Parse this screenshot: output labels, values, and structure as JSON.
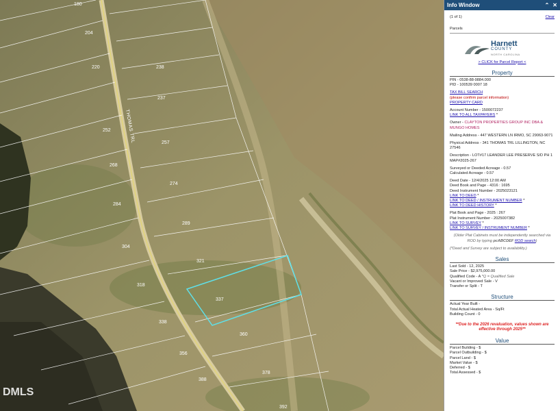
{
  "map": {
    "watermark": "DMLS",
    "road_label": "THOMAS TRL",
    "parcel_labels": [
      "180",
      "204",
      "220",
      "238",
      "237",
      "252",
      "257",
      "268",
      "274",
      "284",
      "289",
      "304",
      "321",
      "318",
      "337",
      "338",
      "360",
      "356",
      "378",
      "388",
      "392"
    ]
  },
  "info_window": {
    "title": "Info Window",
    "collapse_icon": "chevron-up-icon",
    "close_icon": "close-icon",
    "count": "(1 of 1)",
    "clear_label": "Clear",
    "section_label": "Parcels",
    "logo": {
      "name": "Harnett",
      "county": "COUNTY",
      "state": "NORTH CAROLINA"
    },
    "parcel_report_link": "> CLICK for Parcel Report <",
    "property": {
      "heading": "Property",
      "pin": "PIN - 0538-88-9884.000",
      "pid": "PID - 100539 0007 18",
      "tax_bill_link": "TAX BILL SEARCH",
      "tax_bill_note": "(please confirm parcel information)",
      "property_card_link": "PROPERTY CARD",
      "account_number": "Account Number - 1500072237",
      "all_taxpayers_link": "LINK TO ALL TAXPAYERS",
      "owner_label": "Owner - ",
      "owner_value": "CLAYTON PROPERTIES GROUP INC DBA & MUNGO HOMES",
      "mailing_address": "Mailing Address - 447 WESTERN LN IRMO, SC 29063-9071",
      "physical_address": "Physical Address - 341 THOMAS TRL LILLINGTON, NC 27546",
      "description": "Description - LOT#17 LEANDER LEE PRESERVE S/D PH 1 MAP#2025-267",
      "surveyed_acreage": "Surveyed or Deeded Acreage - 0.57",
      "calculated_acreage": "Calculated Acreage - 0.57",
      "deed_date": "Deed Date - 12/4/2025 12:00 AM",
      "deed_book_page": "Deed Book and Page - 4316 : 1695",
      "deed_instrument": "Deed Instrument Number - 2025023121",
      "link_deed": "LINK TO DEED",
      "link_deed_instrument": "LINK TO DEED / INSTRUMENT NUMBER",
      "link_deed_history": "LINK TO DEED HISTORY",
      "plat_book_page": "Plat Book and Page - 2025 : 267",
      "plat_instrument": "Plat Instrument Number - 2025007382",
      "link_survey": "LINK TO SURVEY",
      "link_survey_instrument": "LINK TO SURVEY / INSTRUMENT NUMBER",
      "plat_note_pre": "(Older Plat Cabinets must be independently searched via ROD by typing ",
      "plat_note_code": "pcABCDEF",
      "plat_note_link": "ROD search",
      "deed_survey_note": "(*Deed and Survey are subject to availability.)",
      "asterisk": "*"
    },
    "sales": {
      "heading": "Sales",
      "last_sold": "Last Sold - 12, 2025",
      "sale_price": "Sale Price - $2,975,000.00",
      "qualified_code_pre": "Qualified Code - A ",
      "qualified_code_note": "*Q = Qualified Sale",
      "vacant_improved": "Vacant or Improved Sale - V",
      "transfer_split": "Transfer or Split - T"
    },
    "structure": {
      "heading": "Structure",
      "actual_year_built": "Actual Year Built -",
      "heated_area": "Total Actual Heated Area - Sq/Ft",
      "building_count": "Building Count - 0"
    },
    "revaluation_note": "**Due to the 2026 revaluation, values shown are effective through 2025**",
    "value": {
      "heading": "Value",
      "parcel_building": "Parcel Building - $",
      "parcel_outbuilding": "Parcel Outbuilding - $",
      "parcel_land": "Parcel Land - $",
      "market_value": "Market Value - $",
      "deferred": "Deferred - $",
      "total_assessed": "Total Assessed - $"
    }
  }
}
